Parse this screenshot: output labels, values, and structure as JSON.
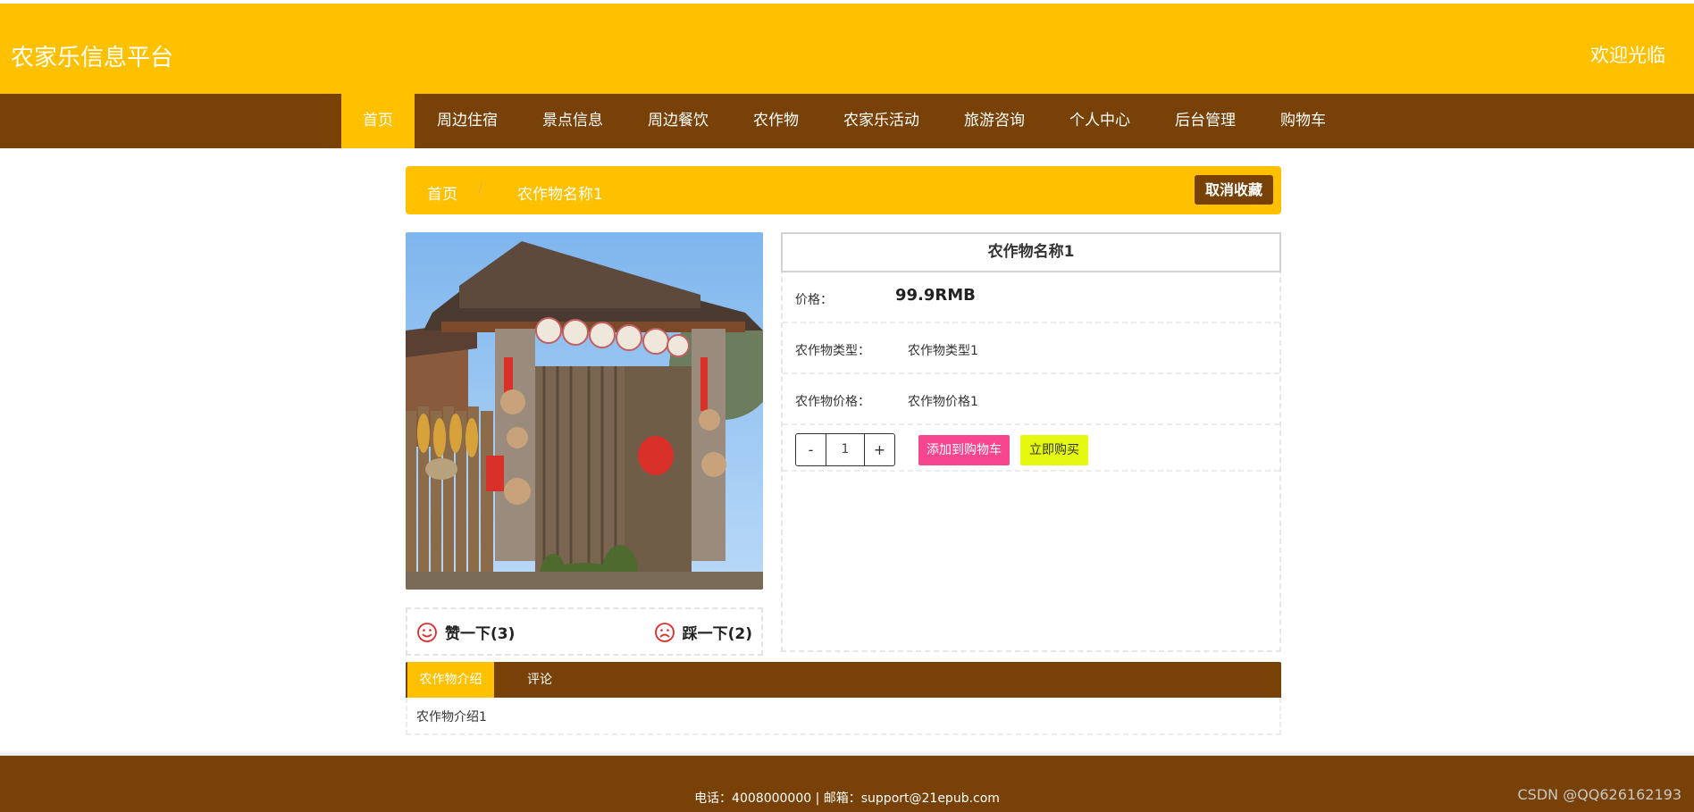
{
  "header": {
    "brand": "农家乐信息平台",
    "welcome": "欢迎光临"
  },
  "nav": {
    "items": [
      {
        "label": "首页",
        "active": true
      },
      {
        "label": "周边住宿"
      },
      {
        "label": "景点信息"
      },
      {
        "label": "周边餐饮"
      },
      {
        "label": "农作物"
      },
      {
        "label": "农家乐活动"
      },
      {
        "label": "旅游咨询"
      },
      {
        "label": "个人中心"
      },
      {
        "label": "后台管理"
      },
      {
        "label": "购物车"
      }
    ]
  },
  "breadcrumb": {
    "home": "首页",
    "separator": "/",
    "current": "农作物名称1",
    "unfavorite_label": "取消收藏"
  },
  "product": {
    "title": "农作物名称1",
    "price_label": "价格：",
    "price_value": "99.9RMB",
    "type_label": "农作物类型：",
    "type_value": "农作物类型1",
    "crop_price_label": "农作物价格：",
    "crop_price_value": "农作物价格1",
    "quantity": "1",
    "minus": "-",
    "plus": "+",
    "add_to_cart": "添加到购物车",
    "buy_now": "立即购买"
  },
  "votes": {
    "like": "赞一下(3)",
    "dislike": "踩一下(2)"
  },
  "tabs": {
    "intro": "农作物介绍",
    "comments": "评论",
    "intro_content": "农作物介绍1"
  },
  "footer": {
    "contact": "电话：4008000000 | 邮箱：support@21epub.com",
    "watermark": "CSDN @QQ626162193"
  },
  "colors": {
    "primary_yellow": "#ffc000",
    "brown": "#774107",
    "cart_pink": "#f64690",
    "buy_yellow": "#e5f80f"
  }
}
